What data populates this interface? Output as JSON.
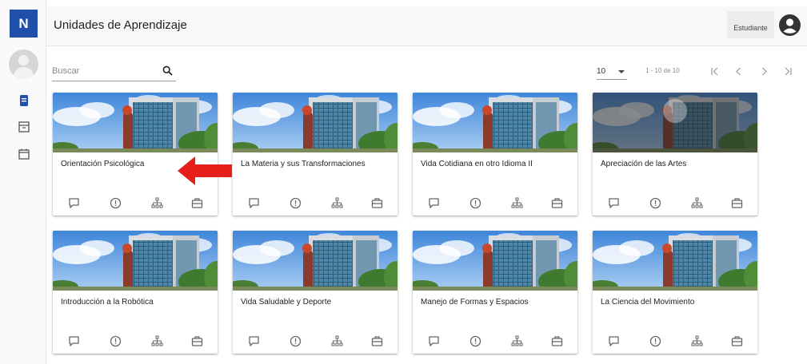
{
  "app": {
    "logo_letter": "N"
  },
  "header": {
    "title": "Unidades de Aprendizaje",
    "role": "Estudiante"
  },
  "search": {
    "placeholder": "Buscar",
    "value": ""
  },
  "pagination": {
    "page_size": "10",
    "range_text": "1 - 10 de 10"
  },
  "cards": [
    {
      "title": "Orientación Psicológica"
    },
    {
      "title": "La Materia y sus Transformaciones"
    },
    {
      "title": "Vida Cotidiana en otro Idioma II"
    },
    {
      "title": "Apreciación de las Artes"
    },
    {
      "title": "Introducción a la Robótica"
    },
    {
      "title": "Vida Saludable y Deporte"
    },
    {
      "title": "Manejo de Formas y Espacios"
    },
    {
      "title": "La Ciencia del Movimiento"
    }
  ],
  "colors": {
    "brand": "#1f4fa8",
    "active_icon": "#1f4fa8",
    "arrow": "#e5201b",
    "sky": "#6fa8e6"
  },
  "icons": {
    "sidebar": [
      "courses-icon",
      "archive-icon",
      "calendar-icon"
    ],
    "card_actions": [
      "forum-icon",
      "info-icon",
      "hierarchy-icon",
      "briefcase-icon"
    ]
  }
}
